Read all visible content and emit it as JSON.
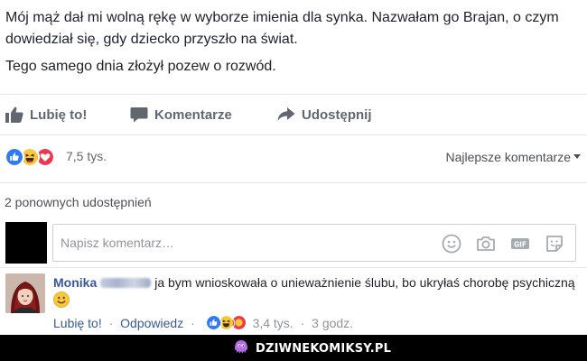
{
  "post": {
    "line1": "Mój mąż dał mi wolną rękę w wyborze imienia dla synka. Nazwałam go Brajan, o czym dowiedział się, gdy dziecko przyszło na świat.",
    "line2": "Tego samego dnia złożył pozew o rozwód."
  },
  "actions": {
    "like": "Lubię to!",
    "comment": "Komentarze",
    "share": "Udostępnij"
  },
  "reactions": {
    "icons": [
      "like-icon",
      "haha-icon",
      "love-icon"
    ],
    "count": "7,5 tys."
  },
  "sort": {
    "label": "Najlepsze komentarze"
  },
  "shares": {
    "label": "2 ponownych udostępnień"
  },
  "composer": {
    "placeholder": "Napisz komentarz…",
    "icons": [
      "emoji-icon",
      "camera-icon",
      "gif-icon",
      "sticker-icon"
    ]
  },
  "comment": {
    "author": "Monika",
    "text": "ja bym wnioskowała o unieważnienie ślubu, bo ukryłaś chorobę psychiczną",
    "like": "Lubię to!",
    "reply": "Odpowiedz",
    "sep": "·",
    "reactions": [
      "like-icon",
      "haha-icon",
      "angry-icon"
    ],
    "reaction_count": "3,4 tys.",
    "time": "3 godz."
  },
  "footer": {
    "brand": "DZIWNEKOMIKSY.PL"
  },
  "colors": {
    "text": "#1d2129",
    "link": "#385898",
    "muted": "#90949c",
    "like_blue": "#2e7bf5",
    "love_red": "#f0364c",
    "haha_yellow": "#f7c83b"
  }
}
